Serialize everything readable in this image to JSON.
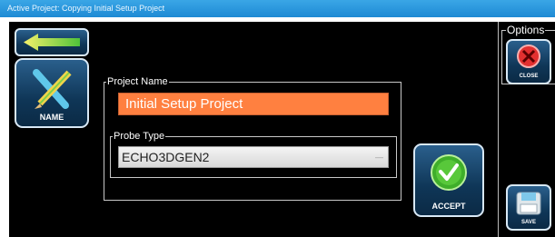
{
  "window": {
    "title": "Active Project: Copying Initial Setup Project"
  },
  "nav": {
    "back_icon": "arrow-left-icon"
  },
  "tools": {
    "name_button_label": "NAME",
    "name_icon": "pencil-ruler-icon"
  },
  "form": {
    "project_name_label": "Project Name",
    "project_name_value": "Initial Setup Project",
    "probe_type_label": "Probe Type",
    "probe_type_value": "ECHO3DGEN2"
  },
  "actions": {
    "accept_label": "ACCEPT",
    "accept_icon": "checkmark-icon"
  },
  "options": {
    "title": "Options",
    "close_label": "CLOSE",
    "close_icon": "close-icon",
    "save_label": "SAVE",
    "save_icon": "save-icon"
  },
  "colors": {
    "accent": "#ff8040",
    "titlebar": "#1e8ad4",
    "button": "#0f3657"
  }
}
